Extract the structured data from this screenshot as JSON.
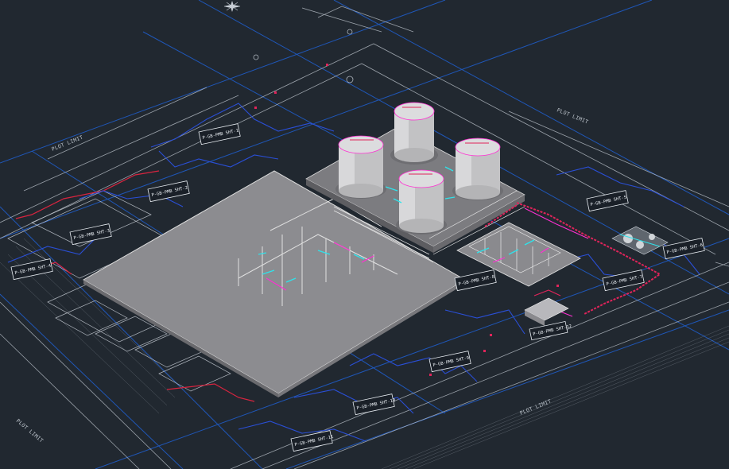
{
  "drawing": {
    "plot_limit_labels": [
      "PLOT LIMIT",
      "PLOT LIMIT",
      "PLOT LIMIT",
      "PLOT LIMIT"
    ],
    "tag_labels": [
      "P-GB-PMB SHT-1",
      "P-GB-PMB SHT-2",
      "P-GB-PMB SHT-3",
      "P-GB-PMB SHT-4",
      "P-GB-PMB SHT-5",
      "P-GB-PMB SHT-6",
      "P-GB-PMB SHT-7",
      "P-GB-PMB SHT-8",
      "P-GB-PMB SHT-9",
      "P-GB-PMB SHT-10",
      "P-GB-PMB SHT-11",
      "P-GB-PMB SHT-12"
    ]
  },
  "colors": {
    "background": "#212830",
    "grid_blue": "#1f5fcf",
    "outline_white": "#c8ced6",
    "pipe_red": "#e0245a",
    "pipe_magenta": "#ff2fd2",
    "pipe_cyan": "#2fe2ea",
    "slab": "#8f8f92",
    "tank": "#c4c4c6"
  },
  "icons": {
    "north_arrow": "compass-rose-icon"
  }
}
